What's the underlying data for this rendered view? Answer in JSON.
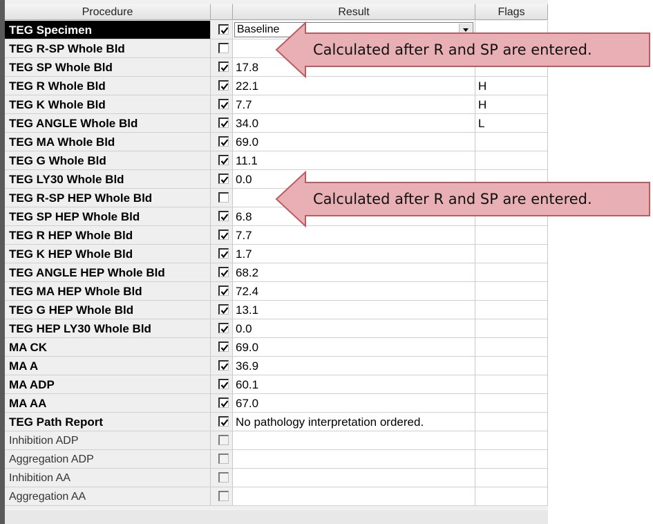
{
  "columns": {
    "procedure": "Procedure",
    "result": "Result",
    "flags": "Flags"
  },
  "rows": [
    {
      "procedure": "TEG Specimen",
      "checked": true,
      "result": "Baseline",
      "flag": "",
      "style": "bold",
      "selected": true,
      "dropdown": true
    },
    {
      "procedure": "TEG R-SP Whole Bld",
      "checked": false,
      "result": "",
      "flag": "",
      "style": "bold"
    },
    {
      "procedure": "TEG SP Whole Bld",
      "checked": true,
      "result": "17.8",
      "flag": "",
      "style": "bold"
    },
    {
      "procedure": "TEG R Whole Bld",
      "checked": true,
      "result": "22.1",
      "flag": "H",
      "style": "bold"
    },
    {
      "procedure": "TEG K Whole Bld",
      "checked": true,
      "result": "7.7",
      "flag": "H",
      "style": "bold"
    },
    {
      "procedure": "TEG ANGLE Whole Bld",
      "checked": true,
      "result": "34.0",
      "flag": "L",
      "style": "bold"
    },
    {
      "procedure": "TEG MA Whole Bld",
      "checked": true,
      "result": "69.0",
      "flag": "",
      "style": "bold"
    },
    {
      "procedure": "TEG G Whole Bld",
      "checked": true,
      "result": "11.1",
      "flag": "",
      "style": "bold"
    },
    {
      "procedure": "TEG LY30 Whole Bld",
      "checked": true,
      "result": "0.0",
      "flag": "",
      "style": "bold"
    },
    {
      "procedure": "TEG R-SP HEP Whole Bld",
      "checked": false,
      "result": "",
      "flag": "",
      "style": "bold"
    },
    {
      "procedure": "TEG SP HEP Whole Bld",
      "checked": true,
      "result": "6.8",
      "flag": "",
      "style": "bold"
    },
    {
      "procedure": "TEG R HEP Whole Bld",
      "checked": true,
      "result": "7.7",
      "flag": "",
      "style": "bold"
    },
    {
      "procedure": "TEG K HEP Whole Bld",
      "checked": true,
      "result": "1.7",
      "flag": "",
      "style": "bold"
    },
    {
      "procedure": "TEG ANGLE HEP Whole Bld",
      "checked": true,
      "result": "68.2",
      "flag": "",
      "style": "bold"
    },
    {
      "procedure": "TEG MA HEP Whole Bld",
      "checked": true,
      "result": "72.4",
      "flag": "",
      "style": "bold"
    },
    {
      "procedure": "TEG G HEP Whole Bld",
      "checked": true,
      "result": "13.1",
      "flag": "",
      "style": "bold"
    },
    {
      "procedure": "TEG HEP LY30 Whole Bld",
      "checked": true,
      "result": "0.0",
      "flag": "",
      "style": "bold"
    },
    {
      "procedure": "MA CK",
      "checked": true,
      "result": "69.0",
      "flag": "",
      "style": "bold"
    },
    {
      "procedure": "MA A",
      "checked": true,
      "result": "36.9",
      "flag": "",
      "style": "bold"
    },
    {
      "procedure": "MA ADP",
      "checked": true,
      "result": "60.1",
      "flag": "",
      "style": "bold"
    },
    {
      "procedure": "MA AA",
      "checked": true,
      "result": "67.0",
      "flag": "",
      "style": "bold"
    },
    {
      "procedure": "TEG Path Report",
      "checked": true,
      "result": "No pathology interpretation ordered.",
      "flag": "",
      "style": "bold"
    },
    {
      "procedure": "Inhibition ADP",
      "checked": false,
      "result": "",
      "flag": "",
      "style": "plain",
      "disabled": true
    },
    {
      "procedure": "Aggregation ADP",
      "checked": false,
      "result": "",
      "flag": "",
      "style": "plain",
      "disabled": true
    },
    {
      "procedure": "Inhibition AA",
      "checked": false,
      "result": "",
      "flag": "",
      "style": "plain",
      "disabled": true
    },
    {
      "procedure": "Aggregation AA",
      "checked": false,
      "result": "",
      "flag": "",
      "style": "plain",
      "disabled": true
    }
  ],
  "callouts": [
    {
      "text": "Calculated after R and SP are entered."
    },
    {
      "text": "Calculated after R and SP are entered."
    }
  ],
  "colors": {
    "callout_fill": "#e8b0b4",
    "callout_stroke": "#c05a5e",
    "selected_bg": "#000000",
    "selected_text": "#ffffff"
  },
  "icons": {
    "checkbox_checked": "checkmark-icon",
    "dropdown": "chevron-down-icon",
    "callout": "arrow-left-icon"
  }
}
